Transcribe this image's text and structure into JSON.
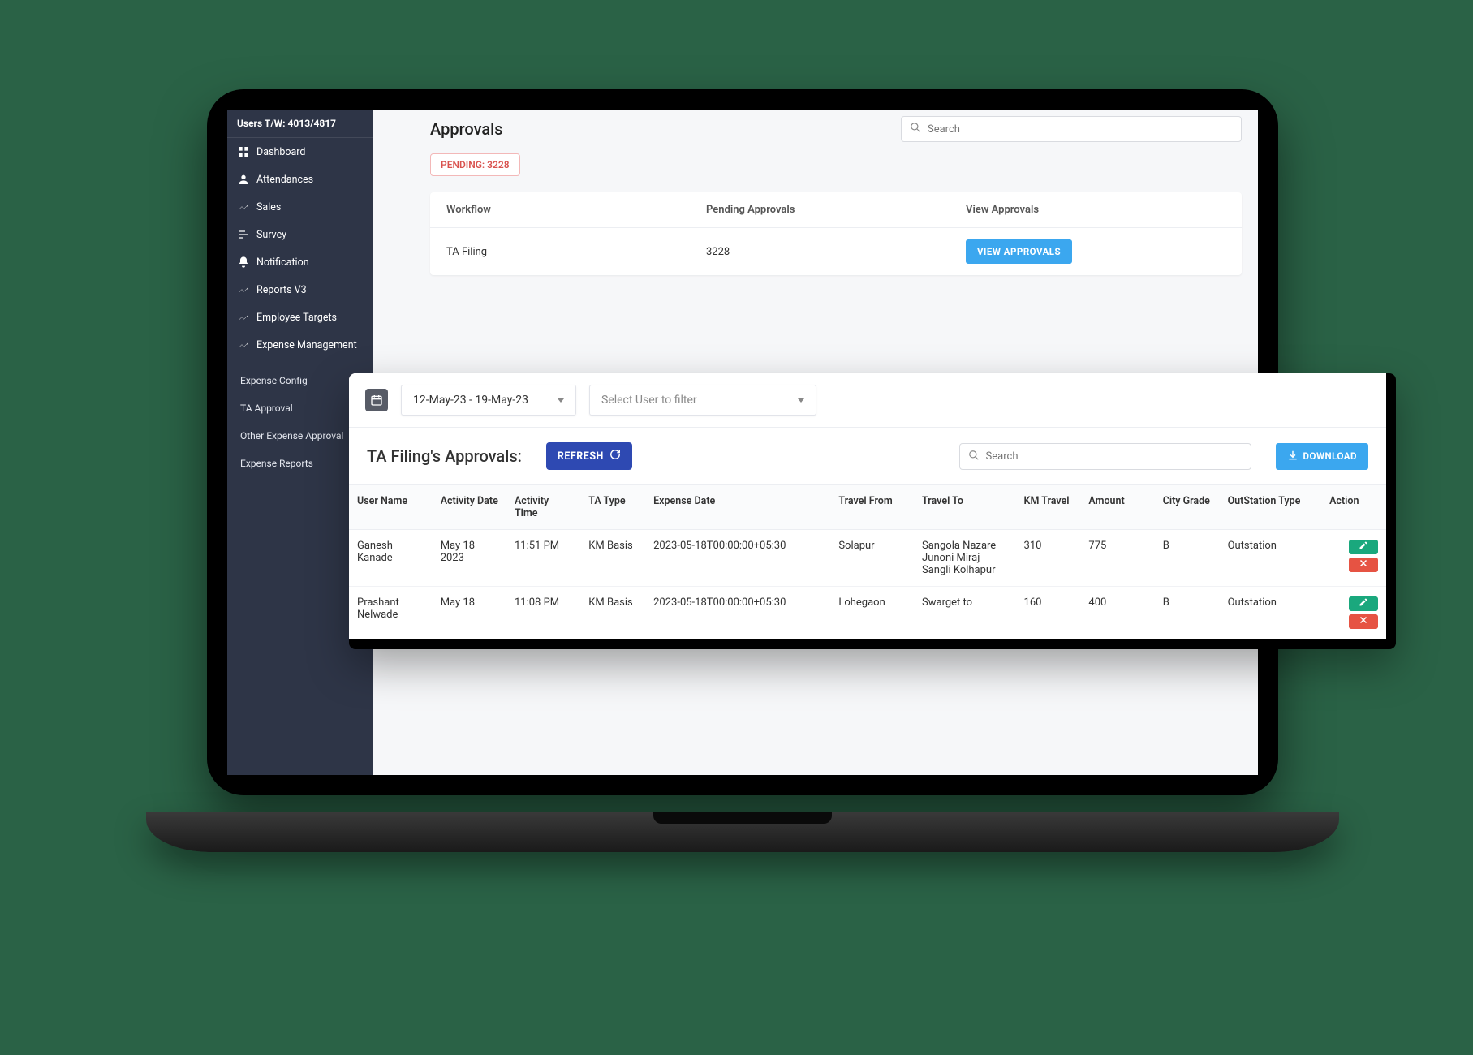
{
  "sidebar": {
    "header": "Users T/W: 4013/4817",
    "items": [
      {
        "icon": "dashboard-icon",
        "label": "Dashboard"
      },
      {
        "icon": "person-icon",
        "label": "Attendances"
      },
      {
        "icon": "growth-icon",
        "label": "Sales"
      },
      {
        "icon": "sliders-icon",
        "label": "Survey"
      },
      {
        "icon": "bell-icon",
        "label": "Notification"
      },
      {
        "icon": "growth-icon",
        "label": "Reports V3"
      },
      {
        "icon": "growth-icon",
        "label": "Employee Targets"
      },
      {
        "icon": "growth-icon",
        "label": "Expense Management"
      }
    ],
    "subitems": [
      "Expense Config",
      "TA Approval",
      "Other Expense Approval",
      "Expense Reports"
    ]
  },
  "approvals": {
    "title": "Approvals",
    "search_placeholder": "Search",
    "pending_chip": "PENDING: 3228",
    "cols": {
      "workflow": "Workflow",
      "pending": "Pending Approvals",
      "view": "View Approvals"
    },
    "row": {
      "workflow": "TA Filing",
      "pending": "3228",
      "view_btn": "VIEW APPROVALS"
    }
  },
  "panel": {
    "date_range": "12-May-23 - 19-May-23",
    "user_filter_placeholder": "Select User to filter",
    "title": "TA Filing's Approvals:",
    "refresh_label": "REFRESH",
    "download_label": "DOWNLOAD",
    "search_placeholder": "Search",
    "headers": {
      "user": "User Name",
      "adate": "Activity Date",
      "atime": "Activity Time",
      "tatype": "TA Type",
      "edate": "Expense Date",
      "tfrom": "Travel From",
      "tto": "Travel To",
      "km": "KM Travel",
      "amount": "Amount",
      "grade": "City Grade",
      "outtype": "OutStation Type",
      "action": "Action"
    },
    "rows": [
      {
        "user": "Ganesh Kanade",
        "adate": "May 18 2023",
        "atime": "11:51 PM",
        "tatype": "KM Basis",
        "edate": "2023-05-18T00:00:00+05:30",
        "tfrom": "Solapur",
        "tto": "Sangola Nazare Junoni Miraj Sangli Kolhapur",
        "km": "310",
        "amount": "775",
        "grade": "B",
        "outtype": "Outstation"
      },
      {
        "user": "Prashant Nelwade",
        "adate": "May 18",
        "atime": "11:08 PM",
        "tatype": "KM Basis",
        "edate": "2023-05-18T00:00:00+05:30",
        "tfrom": "Lohegaon",
        "tto": "Swarget to",
        "km": "160",
        "amount": "400",
        "grade": "B",
        "outtype": "Outstation"
      }
    ]
  }
}
